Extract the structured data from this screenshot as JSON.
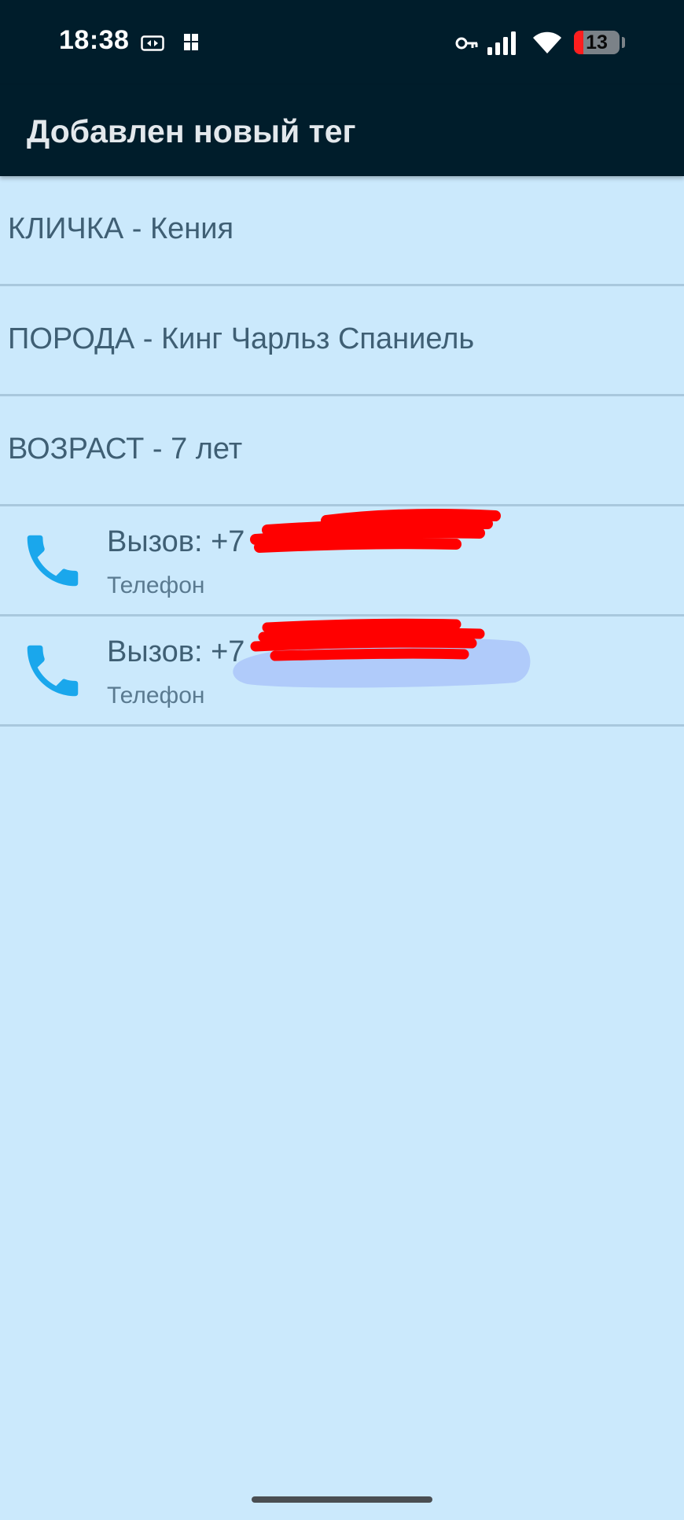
{
  "status_bar": {
    "time": "18:38",
    "battery_level": "13",
    "icons": [
      "card-icon",
      "notification-icon",
      "key-icon",
      "signal-icon",
      "wifi-icon",
      "battery-icon"
    ]
  },
  "appbar": {
    "title": "Добавлен новый тег"
  },
  "records": [
    {
      "text": "КЛИЧКА - Кения"
    },
    {
      "text": "ПОРОДА - Кинг Чарльз Спаниель"
    },
    {
      "text": "ВОЗРАСТ - 7 лет"
    }
  ],
  "calls": [
    {
      "label": "Вызов: +7",
      "type": "Телефон",
      "icon": "phone-icon"
    },
    {
      "label": "Вызов: +7",
      "type": "Телефон",
      "icon": "phone-icon"
    }
  ],
  "colors": {
    "status_bar_bg": "#001d2b",
    "page_bg": "#cbe9fc",
    "divider": "#a9c8dd",
    "text": "#3f5f74",
    "phone_icon": "#1aa7ec",
    "redaction": "#ff0000",
    "battery_low": "#ff1e1e"
  }
}
